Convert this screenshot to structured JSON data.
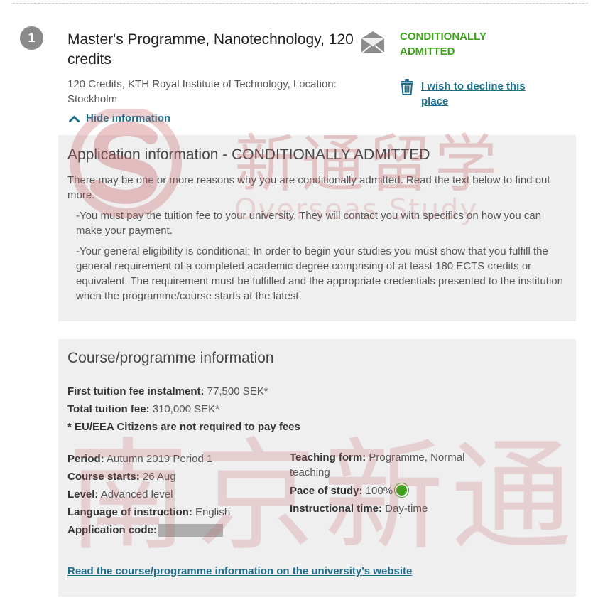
{
  "step": {
    "number": "1"
  },
  "programme": {
    "title": "Master's Programme, Nanotechnology, 120 credits",
    "subtitle": "120 Credits, KTH Royal Institute of Technology, Location: Stockholm",
    "toggle_label": "Hide information"
  },
  "status": {
    "label": "CONDITIONALLY ADMITTED",
    "color": "#3ea21c",
    "icon": "envelope-icon"
  },
  "decline": {
    "label": "I wish to decline this place",
    "icon": "trash-icon"
  },
  "application_info": {
    "heading": "Application information - CONDITIONALLY ADMITTED",
    "intro": "There may be one or more reasons why you are conditionally admitted. Read the text below to find out more.",
    "reasons": [
      "-You must pay the tuition fee to your university. They will contact you with specifics on how you can make your payment.",
      "-Your general eligibility is conditional: In order to begin your studies you must show that you fulfill the general requirement of a completed academic degree comprising of at least 180 ECTS credits or equivalent. The requirement must be fulfilled and the appropriate credentials presented to the institution when the programme/course starts at the latest."
    ]
  },
  "course_info": {
    "heading": "Course/programme information",
    "first_fee_label": "First tuition fee instalment:",
    "first_fee_value": " 77,500 SEK*",
    "total_fee_label": "Total tuition fee:",
    "total_fee_value": " 310,000 SEK*",
    "eu_note": "* EU/EEA Citizens are not required to pay fees",
    "period_label": "Period:",
    "period_value": " Autumn 2019 Period 1",
    "starts_label": "Course starts:",
    "starts_value": " 26 Aug",
    "level_label": "Level:",
    "level_value": " Advanced level",
    "language_label": "Language of instruction:",
    "language_value": " English",
    "app_code_label": "Application code:",
    "teaching_form_label": "Teaching form:",
    "teaching_form_value": " Programme, Normal teaching",
    "pace_label": "Pace of study:",
    "pace_value": " 100%",
    "pace_color": "#3ea21c",
    "instr_time_label": "Instructional time:",
    "instr_time_value": " Day-time",
    "uni_link": "Read the course/programme information on the university's website"
  },
  "watermark": {
    "line1": "新通留学",
    "line2": "Overseas Study",
    "line3": "南京新通"
  },
  "colors": {
    "link": "#1d6f8e",
    "panel_bg": "#efefef",
    "step_circle": "#8a8a8a"
  }
}
